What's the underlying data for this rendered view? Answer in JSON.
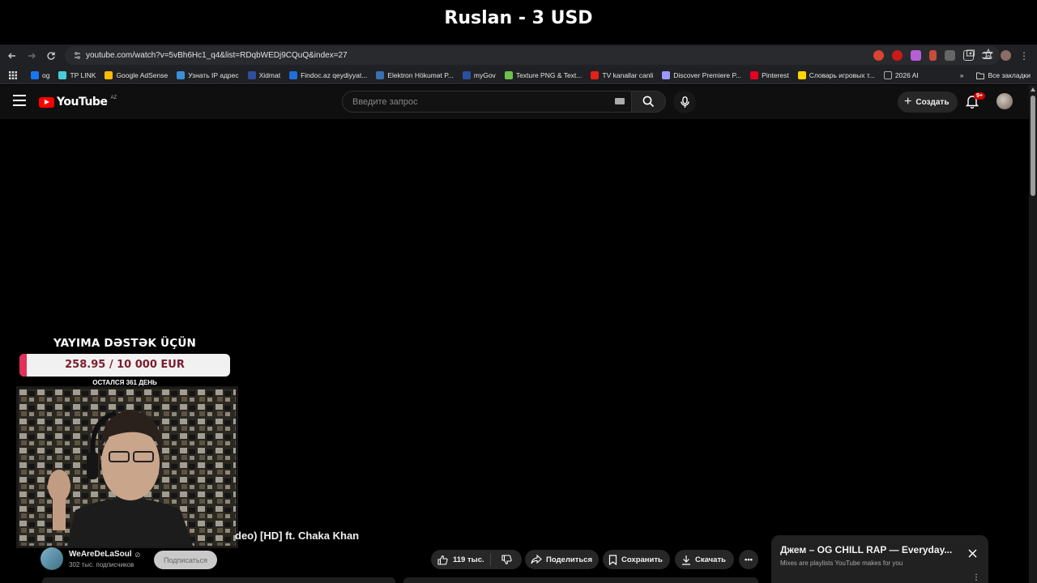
{
  "overlay": {
    "title": "Ruslan - 3 USD"
  },
  "browser": {
    "url": "youtube.com/watch?v=5vBh6Hc1_q4&list=RDqbWEDj9CQuQ&index=27",
    "nav_icons": [
      "back-arrow-icon",
      "forward-arrow-icon",
      "reload-icon",
      "site-info-icon"
    ],
    "bookmarks": [
      {
        "label": "og",
        "color": "#1877f2"
      },
      {
        "label": "TP LINK",
        "color": "#4acbd6"
      },
      {
        "label": "Google AdSense",
        "color": "#fbbc05"
      },
      {
        "label": "Узнать IP адрес",
        "color": "#3b8fd8"
      },
      {
        "label": "Xidmat",
        "color": "#2c4f9e"
      },
      {
        "label": "Findoc.az qeydiyyat...",
        "color": "#1e6fd9"
      },
      {
        "label": "Elektron Hökumət P...",
        "color": "#3a6fb0"
      },
      {
        "label": "myGov",
        "color": "#2c4fa0"
      },
      {
        "label": "Texture PNG & Text...",
        "color": "#6cc24a"
      },
      {
        "label": "TV kanallar canli",
        "color": "#e62117"
      },
      {
        "label": "Discover Premiere P...",
        "color": "#9999ff"
      },
      {
        "label": "Pinterest",
        "color": "#e60023"
      },
      {
        "label": "Словарь игровых т...",
        "color": "#ffd500"
      },
      {
        "label": "2026 AI",
        "color": "#aaaaaa"
      }
    ],
    "all_bookmarks": "Все закладки"
  },
  "youtube": {
    "logo_text": "YouTube",
    "region": "AZ",
    "search_placeholder": "Введите запрос",
    "create_label": "Создать",
    "notification_badge": "9+",
    "video_title": "deo) [HD] ft. Chaka Khan",
    "channel_name": "WeAreDeLaSoul",
    "subscribers": "302 тыс. подписчиков",
    "subscribe_label": "Подписаться",
    "likes": "119 тыс.",
    "share_label": "Поделиться",
    "save_label": "Сохранить",
    "download_label": "Скачать",
    "mix": {
      "title": "Джем – OG CHILL RAP — Everyday...",
      "subtitle": "Mixes are playlists YouTube makes for you"
    }
  },
  "donation": {
    "title": "YAYIMA DƏSTƏK ÜÇÜN",
    "amount": "258.95 / 10 000 EUR",
    "progress_fraction": 0.026,
    "days_left": "ОСТАЛСЯ 361 ДЕНЬ",
    "fill_color": "#e1315b"
  },
  "colors": {
    "youtube_red": "#ff0000",
    "background": "#0f0f0f",
    "browser_chrome": "#202124"
  }
}
